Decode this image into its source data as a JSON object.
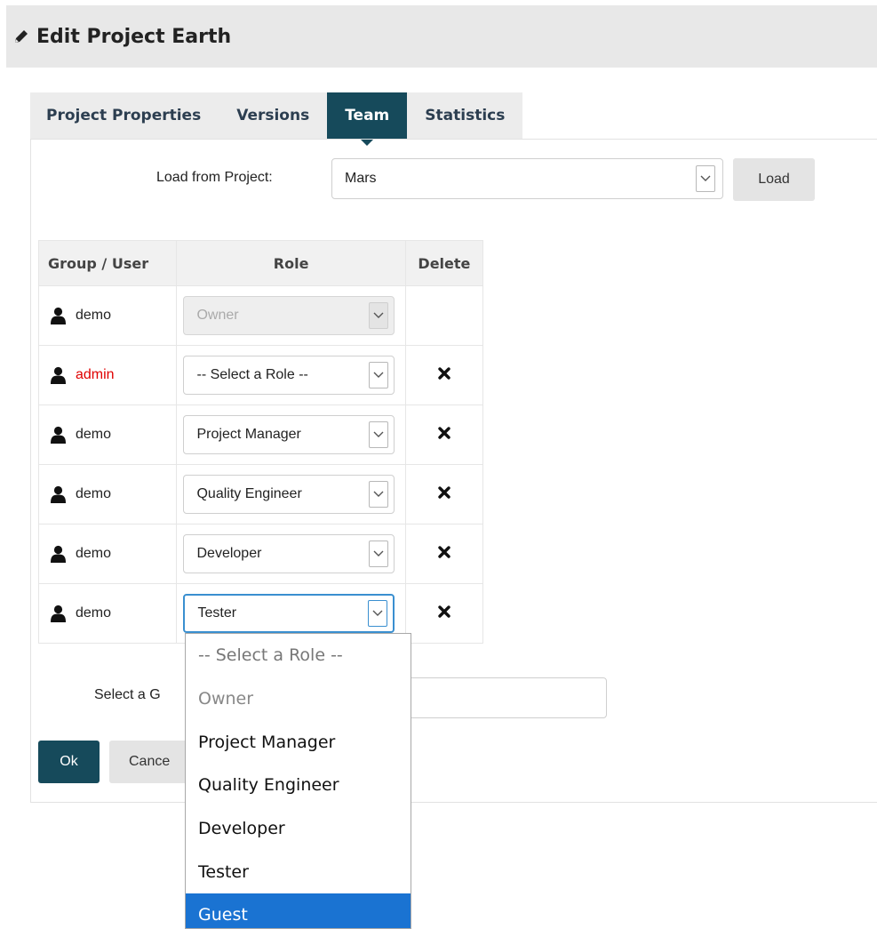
{
  "header": {
    "title": "Edit Project Earth",
    "icon": "pencil-icon"
  },
  "tabs": [
    {
      "label": "Project Properties",
      "active": false
    },
    {
      "label": "Versions",
      "active": false
    },
    {
      "label": "Team",
      "active": true
    },
    {
      "label": "Statistics",
      "active": false
    }
  ],
  "load": {
    "label": "Load from Project:",
    "selected": "Mars",
    "button": "Load"
  },
  "team_table": {
    "headers": {
      "user": "Group / User",
      "role": "Role",
      "delete": "Delete"
    },
    "rows": [
      {
        "user": "demo",
        "role": "Owner",
        "role_disabled": true,
        "deletable": false,
        "user_color": "#222222"
      },
      {
        "user": "admin",
        "role": "-- Select a Role --",
        "role_disabled": false,
        "deletable": true,
        "user_color": "#e00000"
      },
      {
        "user": "demo",
        "role": "Project Manager",
        "role_disabled": false,
        "deletable": true,
        "user_color": "#222222"
      },
      {
        "user": "demo",
        "role": "Quality Engineer",
        "role_disabled": false,
        "deletable": true,
        "user_color": "#222222"
      },
      {
        "user": "demo",
        "role": "Developer",
        "role_disabled": false,
        "deletable": true,
        "user_color": "#222222"
      },
      {
        "user": "demo",
        "role": "Tester",
        "role_disabled": false,
        "deletable": true,
        "focused": true,
        "user_color": "#222222"
      }
    ]
  },
  "group_select": {
    "label_visible": "Select a G"
  },
  "actions": {
    "ok": "Ok",
    "cancel_visible": "Cance"
  },
  "role_dropdown": {
    "options": [
      {
        "label": "-- Select a Role --",
        "state": "placeholder"
      },
      {
        "label": "Owner",
        "state": "disabled"
      },
      {
        "label": "Project Manager",
        "state": "normal"
      },
      {
        "label": "Quality Engineer",
        "state": "normal"
      },
      {
        "label": "Developer",
        "state": "normal"
      },
      {
        "label": "Tester",
        "state": "normal"
      },
      {
        "label": "Guest",
        "state": "highlighted"
      }
    ]
  },
  "colors": {
    "accent": "#164a5b",
    "highlight": "#1a73d2",
    "error_user": "#e00000"
  }
}
